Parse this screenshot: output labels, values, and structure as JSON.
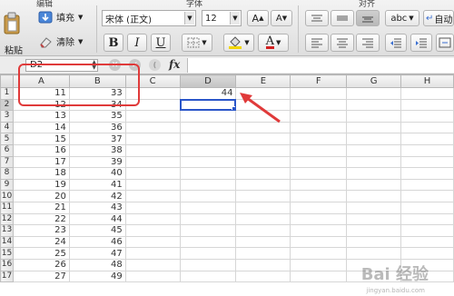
{
  "ribbon": {
    "groups": {
      "edit": "编辑",
      "font": "字体",
      "align": "对齐"
    },
    "paste_label": "粘贴",
    "fill_label": "填充",
    "clear_label": "清除",
    "font_name": "宋体 (正文)",
    "font_size": "12",
    "grow_font": "A",
    "shrink_font": "A",
    "bold": "B",
    "italic": "I",
    "underline": "U",
    "font_color_glyph": "A",
    "wrap_label": "abc",
    "auto_label": "自动"
  },
  "formula_bar": {
    "name_box": "D2",
    "cancel_glyph": "✕",
    "confirm_glyph": "✓",
    "fx": "fx",
    "formula": ""
  },
  "columns": [
    "A",
    "B",
    "C",
    "D",
    "E",
    "F",
    "G",
    "H"
  ],
  "active_column": "D",
  "active_row": "2",
  "rows": [
    {
      "r": "1",
      "A": "11",
      "B": "33",
      "D": "44"
    },
    {
      "r": "2",
      "A": "12",
      "B": "34",
      "D": ""
    },
    {
      "r": "3",
      "A": "13",
      "B": "35",
      "D": ""
    },
    {
      "r": "4",
      "A": "14",
      "B": "36",
      "D": ""
    },
    {
      "r": "5",
      "A": "15",
      "B": "37",
      "D": ""
    },
    {
      "r": "6",
      "A": "16",
      "B": "38",
      "D": ""
    },
    {
      "r": "7",
      "A": "17",
      "B": "39",
      "D": ""
    },
    {
      "r": "8",
      "A": "18",
      "B": "40",
      "D": ""
    },
    {
      "r": "9",
      "A": "19",
      "B": "41",
      "D": ""
    },
    {
      "r": "10",
      "A": "20",
      "B": "42",
      "D": ""
    },
    {
      "r": "11",
      "A": "21",
      "B": "43",
      "D": ""
    },
    {
      "r": "12",
      "A": "22",
      "B": "44",
      "D": ""
    },
    {
      "r": "13",
      "A": "23",
      "B": "45",
      "D": ""
    },
    {
      "r": "14",
      "A": "24",
      "B": "46",
      "D": ""
    },
    {
      "r": "15",
      "A": "25",
      "B": "47",
      "D": ""
    },
    {
      "r": "16",
      "A": "26",
      "B": "48",
      "D": ""
    },
    {
      "r": "17",
      "A": "27",
      "B": "49",
      "D": ""
    }
  ],
  "colors": {
    "selection": "#2b56c9",
    "annotation": "#e03a3a"
  },
  "watermark": {
    "main": "Bai 经验",
    "sub": "jingyan.baidu.com"
  }
}
